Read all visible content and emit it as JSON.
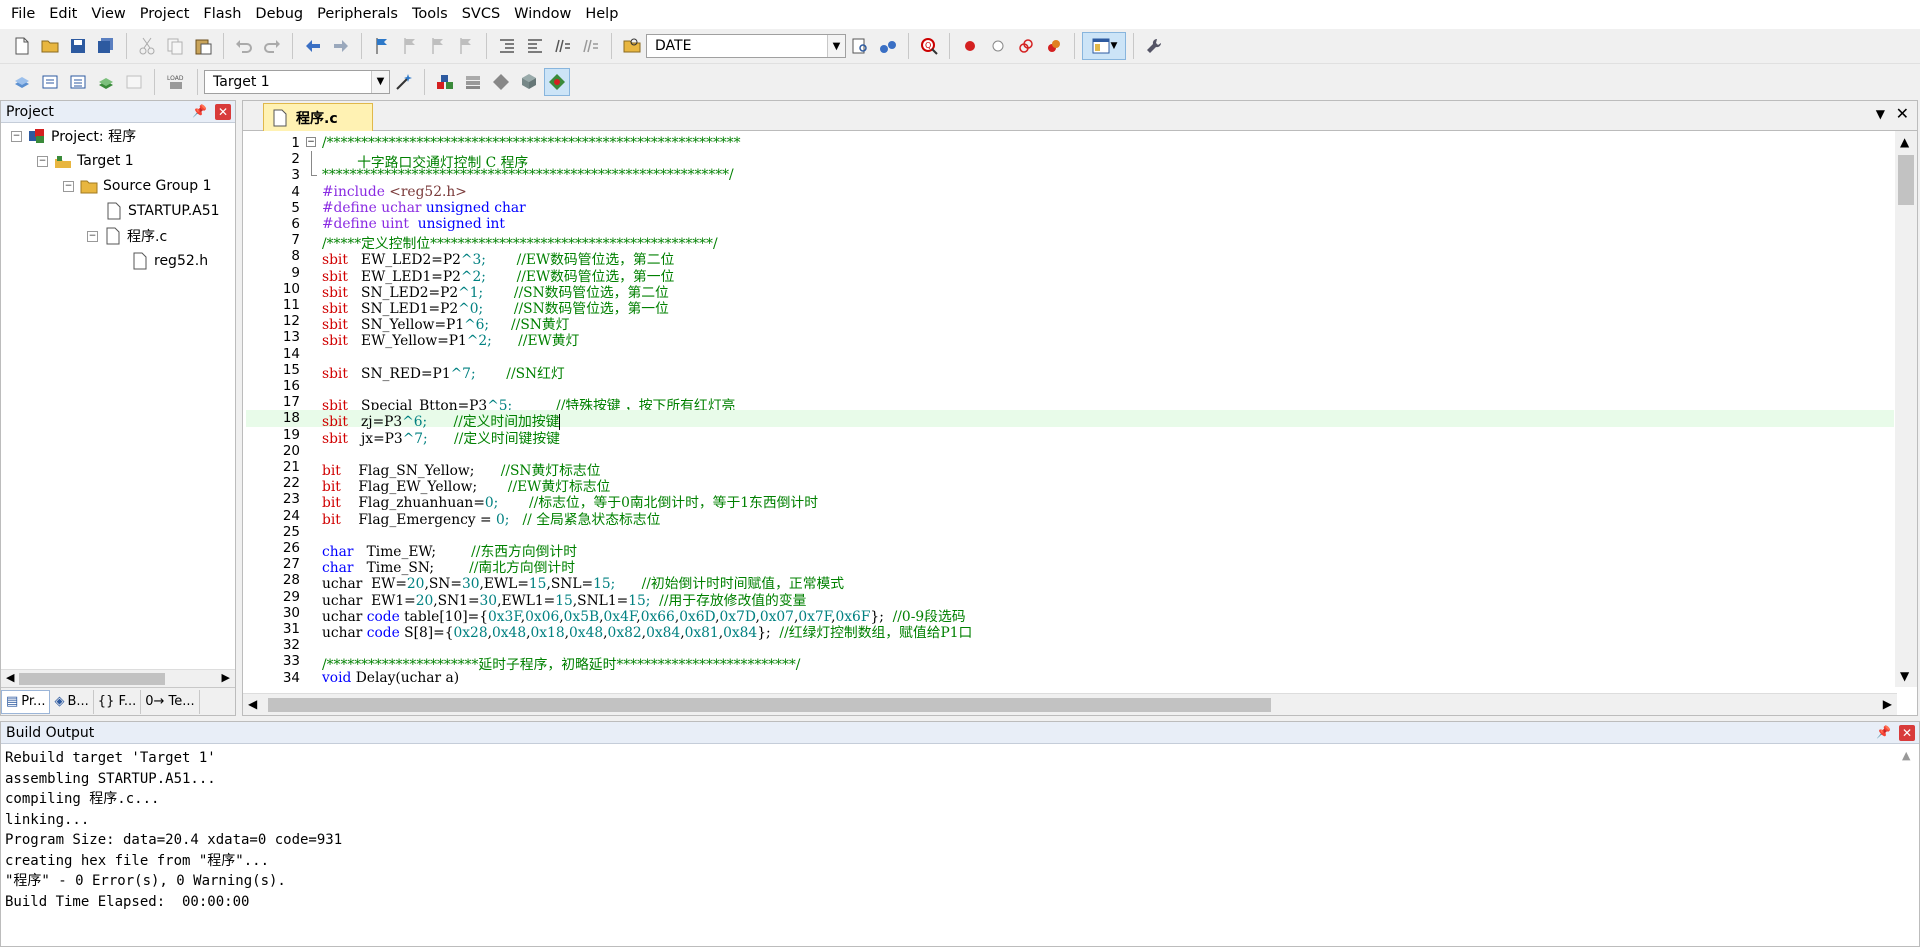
{
  "menu": [
    "File",
    "Edit",
    "View",
    "Project",
    "Flash",
    "Debug",
    "Peripherals",
    "Tools",
    "SVCS",
    "Window",
    "Help"
  ],
  "toolbar": {
    "find_combo_value": "DATE",
    "target_combo_value": "Target 1",
    "load_label": "LOAD"
  },
  "project_panel": {
    "title": "Project",
    "pin": "📌",
    "close": "✕",
    "tree": {
      "root": "Project: 程序",
      "target": "Target 1",
      "group": "Source Group 1",
      "file1": "STARTUP.A51",
      "file2": "程序.c",
      "file3": "reg52.h"
    },
    "tabs": [
      "Pr...",
      "B...",
      "{} F...",
      "0→ Te..."
    ]
  },
  "editor": {
    "tab_name": "程序.c",
    "lines": [
      {
        "n": "1",
        "fold": "minus"
      },
      {
        "n": "2"
      },
      {
        "n": "3",
        "fold": "end"
      },
      {
        "n": "4"
      },
      {
        "n": "5"
      },
      {
        "n": "6"
      },
      {
        "n": "7"
      },
      {
        "n": "8"
      },
      {
        "n": "9"
      },
      {
        "n": "10"
      },
      {
        "n": "11"
      },
      {
        "n": "12"
      },
      {
        "n": "13"
      },
      {
        "n": "14"
      },
      {
        "n": "15"
      },
      {
        "n": "16"
      },
      {
        "n": "17"
      },
      {
        "n": "18"
      },
      {
        "n": "19"
      },
      {
        "n": "20"
      },
      {
        "n": "21"
      },
      {
        "n": "22"
      },
      {
        "n": "23"
      },
      {
        "n": "24"
      },
      {
        "n": "25"
      },
      {
        "n": "26"
      },
      {
        "n": "27"
      },
      {
        "n": "28"
      },
      {
        "n": "29"
      },
      {
        "n": "30"
      },
      {
        "n": "31"
      },
      {
        "n": "32"
      },
      {
        "n": "33"
      },
      {
        "n": "34"
      }
    ],
    "code": {
      "l1": "/************************************************************",
      "l2": "        十字路口交通灯控制 C 程序",
      "l3": "***********************************************************/",
      "l4a": "#include ",
      "l4b": "<reg52.h>",
      "l5a": "#define uchar ",
      "l5b": "unsigned char",
      "l6a": "#define uint  ",
      "l6b": "unsigned int",
      "l7": "/*****定义控制位*****************************************/",
      "l8a": "sbit",
      "l8b": "   EW_LED2=P2",
      "l8c": "^3;",
      "l8d": "       //EW数码管位选，第二位",
      "l9a": "sbit",
      "l9b": "   EW_LED1=P2",
      "l9c": "^2;",
      "l9d": "       //EW数码管位选，第一位",
      "l10a": "sbit",
      "l10b": "   SN_LED2=P2",
      "l10c": "^1;",
      "l10d": "       //SN数码管位选，第二位",
      "l11a": "sbit",
      "l11b": "   SN_LED1=P2",
      "l11c": "^0;",
      "l11d": "       //SN数码管位选，第一位",
      "l12a": "sbit",
      "l12b": "   SN_Yellow=P1",
      "l12c": "^6;",
      "l12d": "     //SN黄灯",
      "l13a": "sbit",
      "l13b": "   EW_Yellow=P1",
      "l13c": "^2;",
      "l13d": "      //EW黄灯",
      "l15a": "sbit",
      "l15b": "   SN_RED=P1",
      "l15c": "^7;",
      "l15d": "       //SN红灯",
      "l17a": "sbit",
      "l17b": "   Special_Btton=P3",
      "l17c": "^5;",
      "l17d": "          //特殊按键 ，按下所有红灯亮",
      "l18a": "sbit",
      "l18b": "   zj=P3",
      "l18c": "^6;",
      "l18d": "      //定义时间加按键",
      "l19a": "sbit",
      "l19b": "   jx=P3",
      "l19c": "^7;",
      "l19d": "      //定义时间键按键",
      "l21a": "bit",
      "l21b": "    Flag_SN_Yellow;",
      "l21d": "      //SN黄灯标志位",
      "l22a": "bit",
      "l22b": "    Flag_EW_Yellow;",
      "l22d": "       //EW黄灯标志位",
      "l23a": "bit",
      "l23b": "    Flag_zhuanhuan=",
      "l23c": "0;",
      "l23d": "       //标志位，等于0南北倒计时，等于1东西倒计时",
      "l24a": "bit",
      "l24b": "    Flag_Emergency = ",
      "l24c": "0;",
      "l24d": "   // 全局紧急状态标志位",
      "l26a": "char",
      "l26b": "   Time_EW;",
      "l26d": "        //东西方向倒计时",
      "l27a": "char",
      "l27b": "   Time_SN;",
      "l27d": "        //南北方向倒计时",
      "l28a": "uchar  EW=",
      "l28b": "20",
      "l28c": ",SN=",
      "l28d": "30",
      "l28e": ",EWL=",
      "l28f": "15",
      "l28g": ",SNL=",
      "l28h": "15",
      "l28i": ";",
      "l28j": "      //初始倒计时时间赋值，正常模式",
      "l29a": "uchar  EW1=",
      "l29b": "20",
      "l29c": ",SN1=",
      "l29d": "30",
      "l29e": ",EWL1=",
      "l29f": "15",
      "l29g": ",SNL1=",
      "l29h": "15",
      "l29i": ";",
      "l29j": "  //用于存放修改值的变量",
      "l30a": "uchar ",
      "l30b": "code",
      "l30c": " table[10]={",
      "l30d": "0x3F",
      "l30e": ",",
      "l30f": "0x06",
      "l30g": ",",
      "l30h": "0x5B",
      "l30i": ",",
      "l30j": "0x4F",
      "l30k": ",",
      "l30l": "0x66",
      "l30m": ",",
      "l30n": "0x6D",
      "l30o": ",",
      "l30p": "0x7D",
      "l30q": ",",
      "l30r": "0x07",
      "l30s": ",",
      "l30t": "0x7F",
      "l30u": ",",
      "l30v": "0x6F",
      "l30w": "};",
      "l30x": "  //0-9段选码",
      "l31a": "uchar ",
      "l31b": "code",
      "l31c": " S[8]={",
      "l31d": "0x28",
      "l31e": ",",
      "l31f": "0x48",
      "l31g": ",",
      "l31h": "0x18",
      "l31i": ",",
      "l31j": "0x48",
      "l31k": ",",
      "l31l": "0x82",
      "l31m": ",",
      "l31n": "0x84",
      "l31o": ",",
      "l31p": "0x81",
      "l31q": ",",
      "l31r": "0x84",
      "l31s": "};",
      "l31t": "  //红绿灯控制数组，赋值给P1口",
      "l33": "/**********************延时子程序，初略延时**************************/",
      "l34a": "void",
      "l34b": " Delay(uchar a)"
    }
  },
  "build_output": {
    "title": "Build Output",
    "lines": [
      "Rebuild target 'Target 1'",
      "assembling STARTUP.A51...",
      "compiling 程序.c...",
      "linking...",
      "Program Size: data=20.4 xdata=0 code=931",
      "creating hex file from \"程序\"...",
      "\"程序\" - 0 Error(s), 0 Warning(s).",
      "Build Time Elapsed:  00:00:00"
    ]
  },
  "colors": {
    "keyword": "#0000ff",
    "sbit": "#d00000",
    "comment": "#008000",
    "number": "#008080",
    "highlight_line": "#e8fbe9",
    "tab_active": "#fff2b3"
  }
}
